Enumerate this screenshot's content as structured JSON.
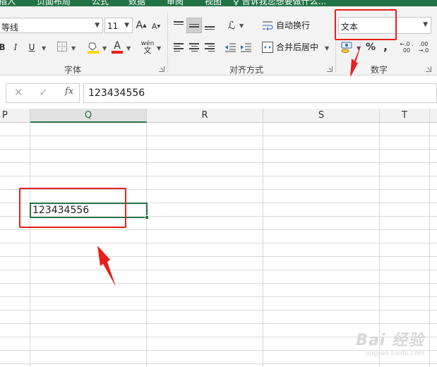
{
  "tabs": [
    {
      "label": "插入"
    },
    {
      "label": "页面布局"
    },
    {
      "label": "公式"
    },
    {
      "label": "数据"
    },
    {
      "label": "审阅"
    },
    {
      "label": "视图"
    },
    {
      "label": "告诉我您想要做什么..."
    }
  ],
  "font_group": {
    "label": "字体",
    "font_name": "等线",
    "font_size": "11",
    "grow_label": "A",
    "shrink_label": "A",
    "bold": "B",
    "italic": "I",
    "underline": "U",
    "font_color_label": "A",
    "phonetic_label": "wén"
  },
  "align_group": {
    "label": "对齐方式",
    "wrap_text": "自动换行",
    "merge_center": "合并后居中"
  },
  "number_group": {
    "label": "数字",
    "format_value": "文本",
    "percent": "%",
    "comma": ",",
    "increase_decimal": "←.0 .00",
    "decrease_decimal": ".00 →.0"
  },
  "formula_bar": {
    "cancel": "✕",
    "enter": "✓",
    "fx": "fx",
    "value": "123434556"
  },
  "columns": [
    "P",
    "Q",
    "R",
    "S",
    "T"
  ],
  "active_column": "Q",
  "selected_cell": {
    "value": "123434556"
  },
  "watermark": {
    "text": "Bai 经验",
    "sub": "jingyan.baidu.com"
  },
  "colors": {
    "accent": "#217346",
    "annotation": "#e8201a",
    "font_color": "#e8201a",
    "fill_color": "#ffd800"
  }
}
